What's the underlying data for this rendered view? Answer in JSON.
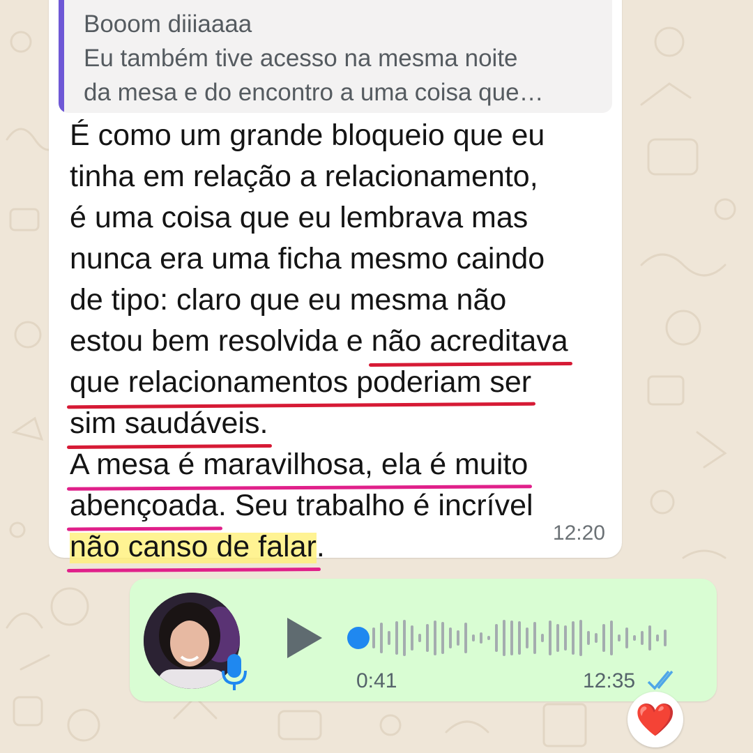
{
  "quoted_message": {
    "text": "Booom diiiaaaa\nEu também tive acesso na mesma noite\nda mesa e do encontro a uma coisa que…"
  },
  "message": {
    "lines": [
      "É como um grande bloqueio que eu",
      "tinha em relação a relacionamento,",
      "é uma coisa que eu lembrava mas",
      "nunca era uma ficha mesmo caindo",
      "de tipo: claro que eu mesma não"
    ],
    "line6_before": "estou bem resolvida e ",
    "line6_highlight": "não acreditava",
    "line7_highlight": "que relacionamentos poderiam ser",
    "line8_highlight": "sim saudáveis.",
    "line9_highlight": "A mesa é maravilhosa, ela é muito",
    "line10_highlight": "abençoada",
    "line10_after": ". Seu trabalho é incrível",
    "line11_highlight": "não canso de falar",
    "line11_after": ".",
    "time": "12:20"
  },
  "voice_note": {
    "duration": "0:41",
    "time": "12:35",
    "status": "read",
    "progress": 0
  },
  "reaction": {
    "emoji": "❤️"
  },
  "colors": {
    "wallpaper": "#efe6d8",
    "incoming_bubble": "#ffffff",
    "outgoing_bubble": "#d9fdd3",
    "quote_bar": "#6e58d6",
    "underline_red": "#d61a35",
    "underline_pink": "#e0208a",
    "play_button": "#5f6b70",
    "progress_dot": "#1f88f0",
    "read_ticks": "#4fa6e8"
  }
}
